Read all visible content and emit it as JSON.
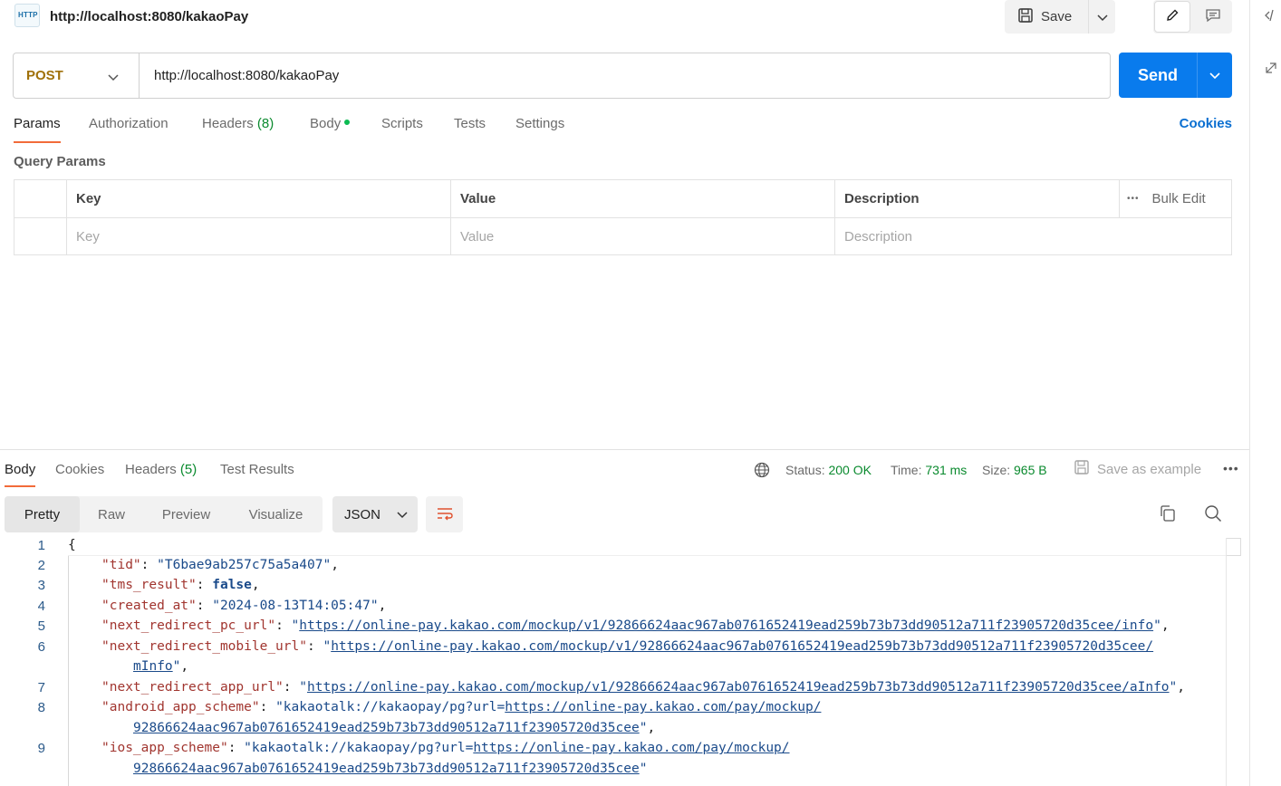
{
  "request": {
    "title": "http://localhost:8080/kakaoPay",
    "http_badge": "HTTP",
    "save_label": "Save",
    "method": "POST",
    "url": "http://localhost:8080/kakaoPay",
    "send_label": "Send"
  },
  "tabs": [
    {
      "label": "Params"
    },
    {
      "label": "Authorization"
    },
    {
      "label": "Headers",
      "count": "(8)"
    },
    {
      "label": "Body"
    },
    {
      "label": "Scripts"
    },
    {
      "label": "Tests"
    },
    {
      "label": "Settings"
    }
  ],
  "cookies_label": "Cookies",
  "query_params": {
    "title": "Query Params",
    "headers": [
      "Key",
      "Value",
      "Description"
    ],
    "bulk_edit": "Bulk Edit",
    "more": "•••",
    "placeholders": [
      "Key",
      "Value",
      "Description"
    ]
  },
  "response": {
    "tabs": [
      {
        "label": "Body"
      },
      {
        "label": "Cookies"
      },
      {
        "label": "Headers",
        "count": "(5)"
      },
      {
        "label": "Test Results"
      }
    ],
    "status_label": "Status:",
    "status_value": "200 OK",
    "time_label": "Time:",
    "time_value": "731 ms",
    "size_label": "Size:",
    "size_value": "965 B",
    "save_example": "Save as example",
    "more": "•••",
    "views": [
      "Pretty",
      "Raw",
      "Preview",
      "Visualize"
    ],
    "format": "JSON"
  },
  "code_lines": [
    {
      "n": "1",
      "text": "{"
    },
    {
      "n": "2",
      "key": "\"tid\"",
      "val": "\"T6bae9ab257c75a5a407\"",
      "tail": ","
    },
    {
      "n": "3",
      "key": "\"tms_result\"",
      "bool": "false",
      "tail": ","
    },
    {
      "n": "4",
      "key": "\"created_at\"",
      "val": "\"2024-08-13T14:05:47\"",
      "tail": ","
    },
    {
      "n": "5",
      "key": "\"next_redirect_pc_url\"",
      "pre": "\"",
      "url": "https://online-pay.kakao.com/mockup/v1/92866624aac967ab0761652419ead259b73b73dd90512a711f23905720d35cee/info",
      "post": "\"",
      "tail": ","
    },
    {
      "n": "6",
      "key": "\"next_redirect_mobile_url\"",
      "pre": "\"",
      "url": "https://online-pay.kakao.com/mockup/v1/92866624aac967ab0761652419ead259b73b73dd90512a711f23905720d35cee/",
      "cont_url": "mInfo",
      "cont_post": "\"",
      "cont_tail": ","
    },
    {
      "n": "7",
      "key": "\"next_redirect_app_url\"",
      "pre": "\"",
      "url": "https://online-pay.kakao.com/mockup/v1/92866624aac967ab0761652419ead259b73b73dd90512a711f23905720d35cee/aInfo",
      "post": "\"",
      "tail": ","
    },
    {
      "n": "8",
      "key": "\"android_app_scheme\"",
      "pre": "\"kakaotalk://kakaopay/pg?url=",
      "url": "https://online-pay.kakao.com/pay/mockup/",
      "cont_url": "92866624aac967ab0761652419ead259b73b73dd90512a711f23905720d35cee",
      "cont_post": "\"",
      "cont_tail": ","
    },
    {
      "n": "9",
      "key": "\"ios_app_scheme\"",
      "pre": "\"kakaotalk://kakaopay/pg?url=",
      "url": "https://online-pay.kakao.com/pay/mockup/",
      "cont_url": "92866624aac967ab0761652419ead259b73b73dd90512a711f23905720d35cee",
      "cont_post": "\""
    }
  ],
  "colors": {
    "accent": "#097bed",
    "method": "#a0710a",
    "status": "#0a8a2e",
    "json_key": "#a1352f",
    "json_string": "#1a4a8a",
    "tab_underline": "#f26b3a"
  },
  "icons": [
    "http-icon",
    "save-icon",
    "chevron-down-icon",
    "pencil-icon",
    "comment-icon",
    "code-icon",
    "collapse-icon",
    "globe-icon",
    "wrap-icon",
    "copy-icon",
    "search-icon"
  ]
}
